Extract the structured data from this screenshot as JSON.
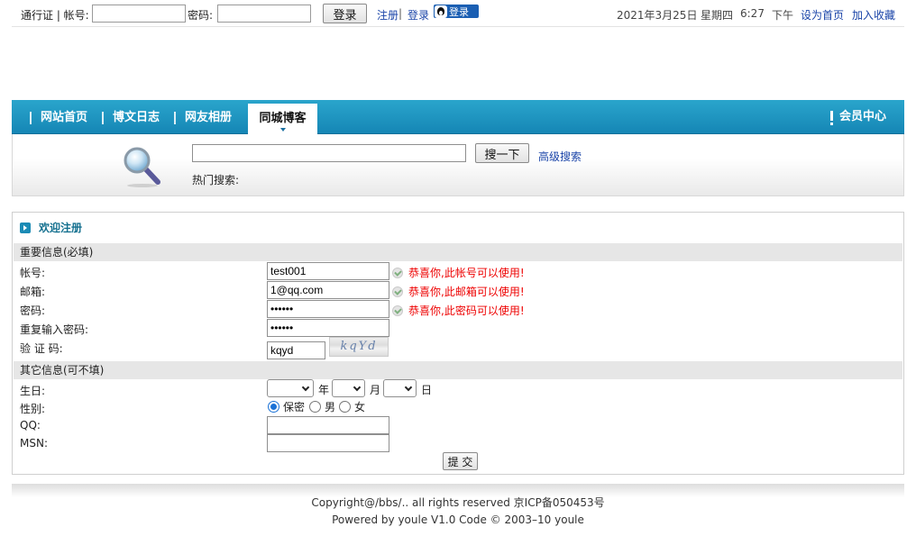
{
  "topbar": {
    "passport_label": "通行证 | 帐号:",
    "password_label": "密码:",
    "login_button": "登录",
    "register_link": "注册",
    "login_link": "登录",
    "qq_login": "登录",
    "date": "2021年3月25日",
    "weekday": "星期四",
    "time": "6:27",
    "ampm": "下午",
    "set_homepage": "设为首页",
    "add_favorite": "加入收藏"
  },
  "nav": {
    "items": [
      "网站首页",
      "博文日志",
      "网友相册"
    ],
    "active": "同城博客",
    "member_center": "会员中心"
  },
  "search": {
    "button": "搜一下",
    "advanced": "高级搜索",
    "hot_label": "热门搜索:"
  },
  "register": {
    "title": "欢迎注册",
    "section_required": "重要信息(必填)",
    "section_optional": "其它信息(可不填)",
    "labels": {
      "account": "帐号:",
      "email": "邮箱:",
      "password": "密码:",
      "repeat_password": "重复输入密码:",
      "captcha": "验 证 码:",
      "birthday": "生日:",
      "gender": "性别:",
      "qq": "QQ:",
      "msn": "MSN:"
    },
    "values": {
      "account": "test001",
      "email": "1@qq.com",
      "password": "••••••",
      "repeat_password": "••••••",
      "captcha": "kqyd"
    },
    "captcha_image_text": "kqYd",
    "messages": {
      "account": "恭喜你,此帐号可以使用!",
      "email": "恭喜你,此邮箱可以使用!",
      "password": "恭喜你,此密码可以使用!"
    },
    "birthday_units": [
      "年",
      "月",
      "日"
    ],
    "gender_options": [
      "保密",
      "男",
      "女"
    ],
    "gender_selected": "保密",
    "submit": "提 交"
  },
  "footer": {
    "copyright": "Copyright@/bbs/.. all rights reserved 京ICP备050453号",
    "powered": "Powered by youle V1.0 Code © 2003–10 youle"
  }
}
